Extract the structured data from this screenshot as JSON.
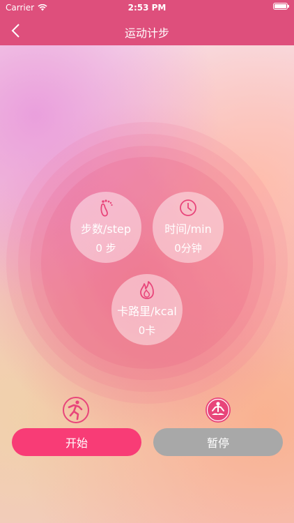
{
  "status_bar": {
    "carrier": "Carrier",
    "time": "2:53 PM",
    "battery_level": 1.0
  },
  "nav": {
    "title": "运动计步"
  },
  "stats": [
    {
      "label": "步数/step",
      "value": "0 步",
      "icon": "footprint-icon"
    },
    {
      "label": "时间/min",
      "value": "0分钟",
      "icon": "clock-icon"
    },
    {
      "label": "卡路里/kcal",
      "value": "0卡",
      "icon": "flame-icon"
    }
  ],
  "modes": {
    "left_icon": "running-person-icon",
    "right_icon": "meditation-icon"
  },
  "buttons": {
    "start": "开始",
    "pause": "暂停"
  },
  "colors": {
    "accent": "#de4f7c",
    "start_button": "#f83c76",
    "pause_button": "#a8a8a8",
    "icon_tint": "#e8457a"
  }
}
